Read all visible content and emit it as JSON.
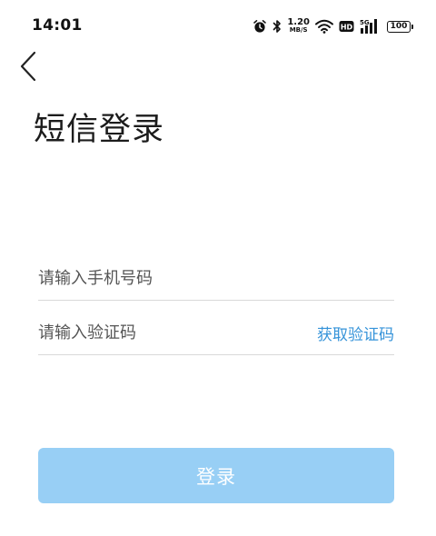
{
  "status_bar": {
    "time": "14:01",
    "net_speed_value": "1.20",
    "net_speed_unit": "MB/S",
    "network_type": "5G",
    "hd_label": "HD",
    "battery_level": "100",
    "icons": [
      "alarm-icon",
      "bluetooth-icon",
      "wifi-icon",
      "hd-icon",
      "signal-icon",
      "battery-icon"
    ]
  },
  "header": {
    "back_icon": "chevron-left-icon",
    "title": "短信登录"
  },
  "form": {
    "phone_placeholder": "请输入手机号码",
    "phone_value": "",
    "code_placeholder": "请输入验证码",
    "code_value": "",
    "get_code_label": "获取验证码"
  },
  "actions": {
    "login_label": "登录"
  },
  "colors": {
    "accent": "#3593d9",
    "login_button_disabled": "#98cff5",
    "divider": "#d9d9d9"
  }
}
